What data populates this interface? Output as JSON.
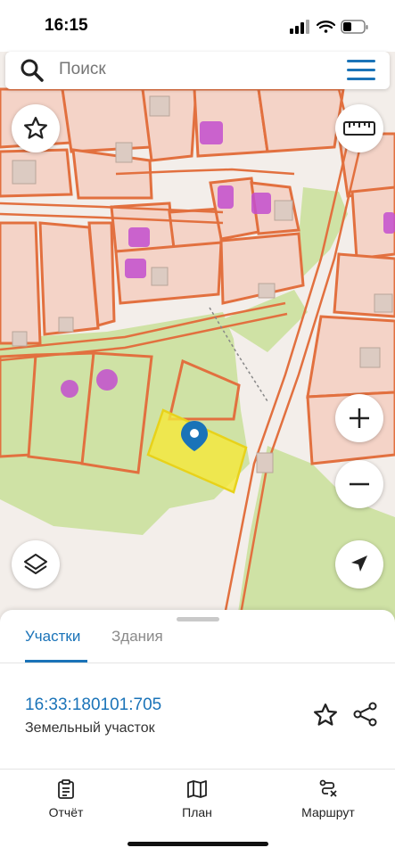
{
  "status_bar": {
    "time": "16:15"
  },
  "search": {
    "placeholder": "Поиск"
  },
  "sheet": {
    "tabs": [
      {
        "label": "Участки",
        "active": true
      },
      {
        "label": "Здания",
        "active": false
      }
    ],
    "parcel": {
      "cadastral_number": "16:33:180101:705",
      "type": "Земельный участок"
    }
  },
  "bottom_nav": {
    "items": [
      {
        "label": "Отчёт",
        "icon": "report-icon"
      },
      {
        "label": "План",
        "icon": "map-icon"
      },
      {
        "label": "Маршрут",
        "icon": "route-icon"
      }
    ]
  },
  "colors": {
    "accent": "#1a73b8",
    "parcel_border": "#e2703f",
    "parcel_fill": "#f4cfc2",
    "green_area": "#c8dd9c",
    "selected_parcel": "#f5e839",
    "building": "#cc55cc"
  }
}
